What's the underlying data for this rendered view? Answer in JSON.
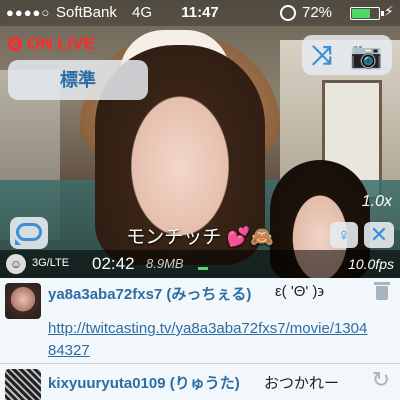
{
  "status_bar": {
    "signal_dots": "●●●●○",
    "carrier": "SoftBank",
    "network": "4G",
    "time": "11:47",
    "battery_percent": "72%",
    "battery_level": 0.72
  },
  "broadcast": {
    "live_label": "ON LIVE",
    "quality_label": "標準",
    "zoom": "1.0x",
    "title": "モンチッチ",
    "title_emoji": "💕🙈"
  },
  "stats": {
    "network_type": "3G/LTE",
    "elapsed": "02:42",
    "data_size": "8.9MB",
    "fps": "10.0fps"
  },
  "comments": [
    {
      "username": "ya8a3aba72fxs7 (みっちぇる)",
      "text": "ε( 'Θ' )϶",
      "link": "http://twitcasting.tv/ya8a3aba72fxs7/movie/130484327"
    },
    {
      "username": "kixyuuryuta0109 (りゅうた)",
      "text": "おつかれー"
    }
  ],
  "colors": {
    "accent": "#3b8fd6",
    "live_red": "#ff2a2a",
    "username_blue": "#2e6da4",
    "comments_bg": "#f2f7fb"
  }
}
